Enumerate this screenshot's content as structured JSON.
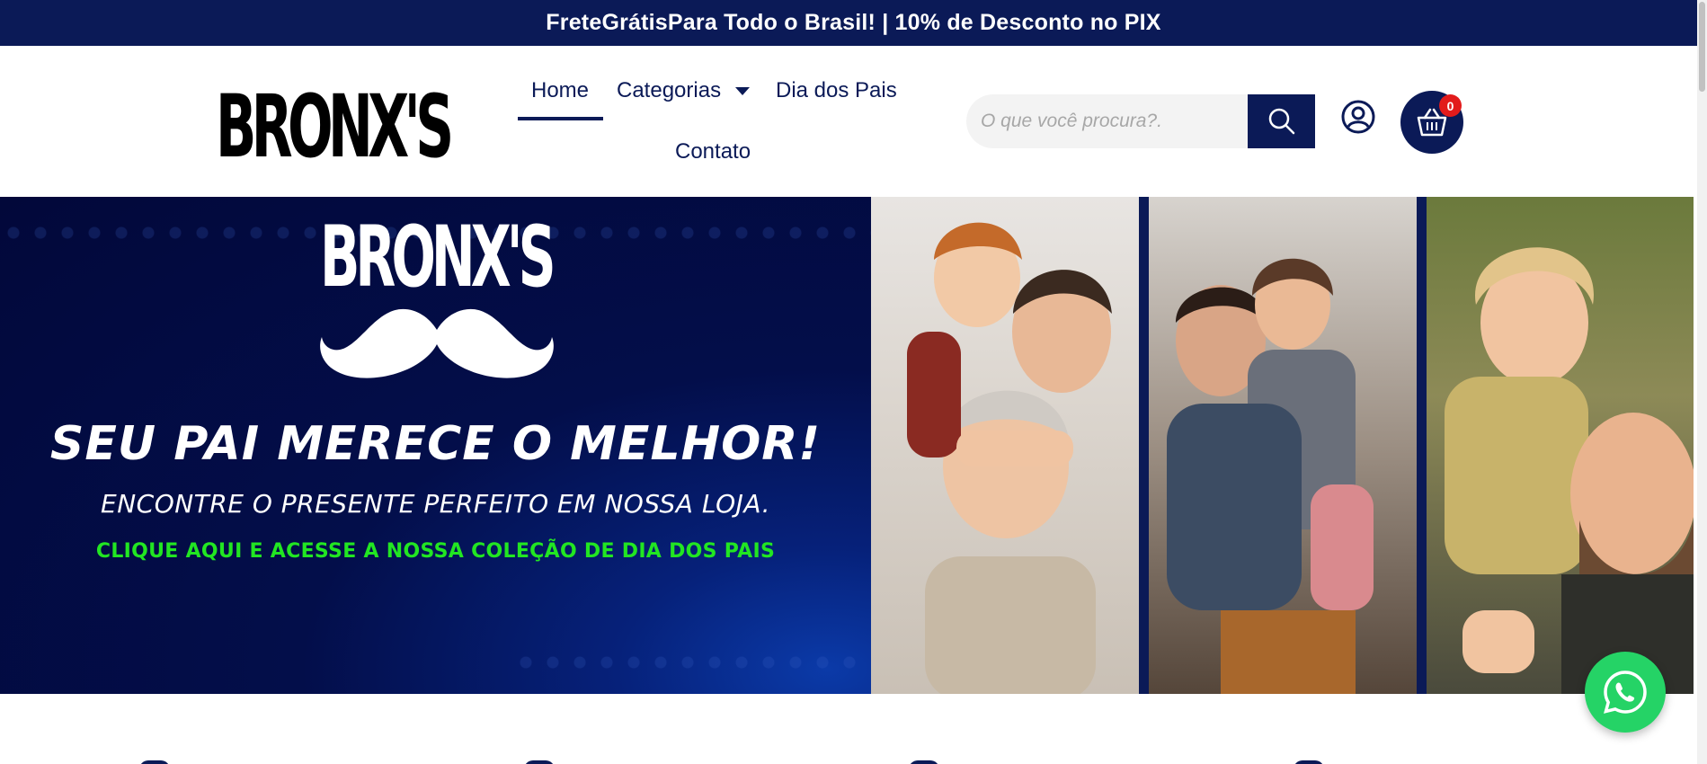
{
  "announcement": {
    "part1": "Frete ",
    "part2": "Grátis",
    "part3": " Para Todo o Brasil! | 10% de Desconto no PIX"
  },
  "header": {
    "logo": "BRONX'S",
    "nav": {
      "home": "Home",
      "categorias": "Categorias",
      "dia_dos_pais": "Dia dos Pais",
      "contato": "Contato"
    },
    "search": {
      "placeholder": "O que você procura?."
    },
    "cart": {
      "count": "0"
    },
    "icons": {
      "search": "search-icon",
      "account": "user-circle-icon",
      "cart": "basket-icon",
      "dropdown": "caret-down-icon"
    }
  },
  "hero": {
    "logo": "BRONX'S",
    "title": "SEU PAI MERECE O MELHOR!",
    "subtitle": "ENCONTRE O PRESENTE PERFEITO EM NOSSA LOJA.",
    "cta": "CLIQUE AQUI E ACESSE A NOSSA COLEÇÃO DE DIA DOS PAIS"
  },
  "floating": {
    "whatsapp_icon": "whatsapp-icon"
  },
  "colors": {
    "brand_navy": "#0b1a57",
    "cta_green": "#22e622",
    "badge_red": "#e21b1b",
    "whatsapp_green": "#25d366"
  }
}
